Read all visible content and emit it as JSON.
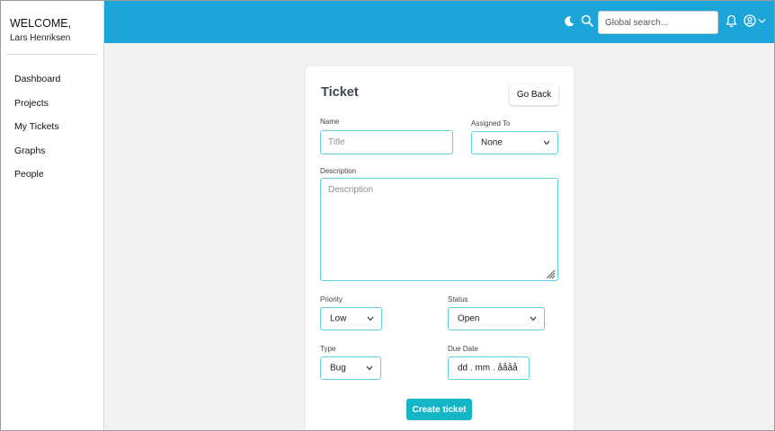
{
  "sidebar": {
    "welcome": "WELCOME,",
    "user_name": "Lars Henriksen",
    "items": [
      {
        "label": "Dashboard"
      },
      {
        "label": "Projects"
      },
      {
        "label": "My Tickets"
      },
      {
        "label": "Graphs"
      },
      {
        "label": "People"
      }
    ]
  },
  "header": {
    "search_placeholder": "Global search...",
    "icons": [
      "moon-icon",
      "search-icon",
      "bell-icon",
      "user-icon",
      "chevron-down-icon"
    ]
  },
  "form": {
    "title": "Ticket",
    "go_back_label": "Go Back",
    "name_label": "Name",
    "name_placeholder": "Title",
    "assigned_label": "Assigned To",
    "assigned_value": "None",
    "description_label": "Description",
    "description_placeholder": "Description",
    "priority_label": "Priority",
    "priority_value": "Low",
    "status_label": "Status",
    "status_value": "Open",
    "type_label": "Type",
    "type_value": "Bug",
    "due_date_label": "Due Date",
    "due_date_value": "dd . mm . åååå",
    "create_label": "Create ticket"
  },
  "colors": {
    "header_bg": "#1ba5d9",
    "accent_border": "#5fd0df",
    "create_button": "#15b5c8",
    "page_bg": "#f1f2f4"
  }
}
